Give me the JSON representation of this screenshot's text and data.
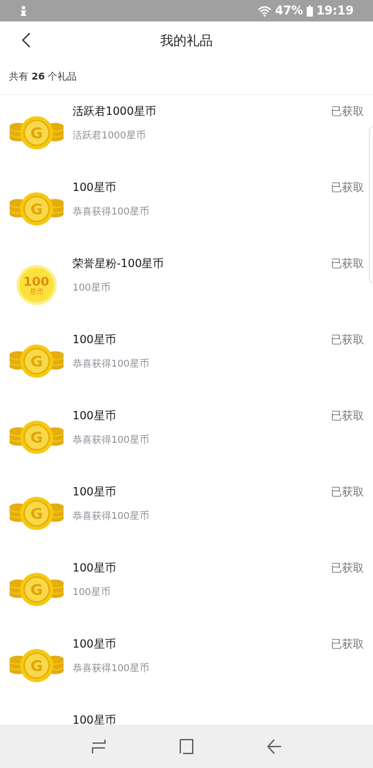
{
  "status_bar": {
    "battery": "47%",
    "time": "19:19"
  },
  "header": {
    "title": "我的礼品"
  },
  "summary": "共有 **26** 个礼品",
  "gifts": [
    {
      "icon": {
        "kind": "coins",
        "mark": "G"
      },
      "title": "活跃君1000星币",
      "subtitle": "活跃君1000星币",
      "status": "已获取"
    },
    {
      "icon": {
        "kind": "coins",
        "mark": "G"
      },
      "title": "100星币",
      "subtitle": "恭喜获得100星币",
      "status": "已获取"
    },
    {
      "icon": {
        "kind": "badge",
        "amount": "100",
        "unit": "星币"
      },
      "title": "荣誉星粉-100星币",
      "subtitle": "100星币",
      "status": "已获取"
    },
    {
      "icon": {
        "kind": "coins",
        "mark": "G"
      },
      "title": "100星币",
      "subtitle": "恭喜获得100星币",
      "status": "已获取"
    },
    {
      "icon": {
        "kind": "coins",
        "mark": "G"
      },
      "title": "100星币",
      "subtitle": "恭喜获得100星币",
      "status": "已获取"
    },
    {
      "icon": {
        "kind": "coins",
        "mark": "G"
      },
      "title": "100星币",
      "subtitle": "恭喜获得100星币",
      "status": "已获取"
    },
    {
      "icon": {
        "kind": "coins",
        "mark": "G"
      },
      "title": "100星币",
      "subtitle": "100星币",
      "status": "已获取"
    },
    {
      "icon": {
        "kind": "coins",
        "mark": "G"
      },
      "title": "100星币",
      "subtitle": "恭喜获得100星币",
      "status": "已获取"
    },
    {
      "title": "100星币"
    }
  ]
}
